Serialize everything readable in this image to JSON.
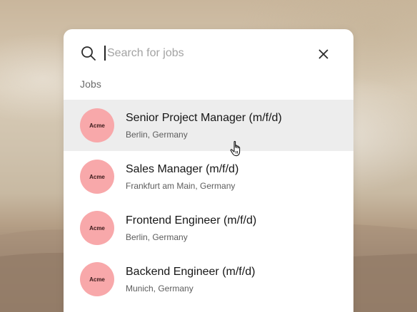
{
  "search": {
    "placeholder": "Search for jobs",
    "value": ""
  },
  "section": {
    "label": "Jobs"
  },
  "jobs": [
    {
      "company": "Acme",
      "title": "Senior Project Manager (m/f/d)",
      "location": "Berlin, Germany",
      "hovered": true
    },
    {
      "company": "Acme",
      "title": "Sales Manager (m/f/d)",
      "location": "Frankfurt am Main, Germany",
      "hovered": false
    },
    {
      "company": "Acme",
      "title": "Frontend Engineer (m/f/d)",
      "location": "Berlin, Germany",
      "hovered": false
    },
    {
      "company": "Acme",
      "title": "Backend Engineer (m/f/d)",
      "location": "Munich, Germany",
      "hovered": false
    }
  ],
  "icons": {
    "search": "search-icon",
    "close": "close-icon",
    "cursor": "hand-pointer-cursor-icon"
  },
  "colors": {
    "logo_bg": "#f8a8aa",
    "hover_row": "#ededed"
  }
}
